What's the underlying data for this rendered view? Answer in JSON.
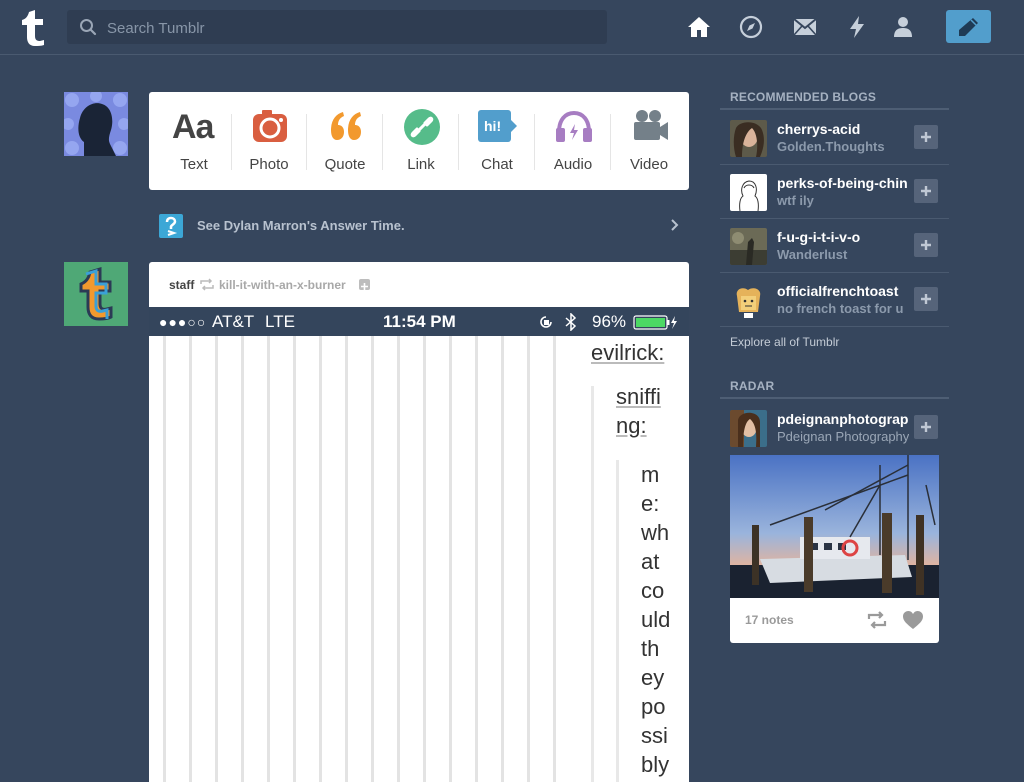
{
  "search": {
    "placeholder": "Search Tumblr"
  },
  "post_types": [
    {
      "label": "Text"
    },
    {
      "label": "Photo"
    },
    {
      "label": "Quote"
    },
    {
      "label": "Link"
    },
    {
      "label": "Chat",
      "icon_text": "hi!"
    },
    {
      "label": "Audio"
    },
    {
      "label": "Video"
    }
  ],
  "post_type_icon_glyph": "Aa",
  "answer_time": {
    "text": "See Dylan Marron's Answer Time."
  },
  "post": {
    "author": "staff",
    "reblogged_from": "kill-it-with-an-x-burner",
    "status_bar": {
      "signal": "●●●○○",
      "carrier": "AT&T",
      "network": "LTE",
      "time": "11:54 PM",
      "battery": "96%"
    },
    "screenshot_lines": {
      "level1": "evilrick:",
      "level2": [
        "sniffi",
        "ng:"
      ],
      "level3": [
        "m",
        "e:",
        "wh",
        "at",
        "co",
        "uld",
        "th",
        "ey",
        "po",
        "ssi",
        "bly"
      ]
    }
  },
  "recommended": {
    "title": "RECOMMENDED BLOGS",
    "blogs": [
      {
        "name": "cherrys-acid",
        "tagline": "Golden.Thoughts"
      },
      {
        "name": "perks-of-being-chin",
        "tagline": "wtf ily"
      },
      {
        "name": "f-u-g-i-t-i-v-o",
        "tagline": "Wanderlust"
      },
      {
        "name": "officialfrenchtoast",
        "tagline": "no french toast for u"
      }
    ],
    "explore": "Explore all of Tumblr"
  },
  "radar": {
    "title": "RADAR",
    "blog": {
      "name": "pdeignanphotography",
      "tagline": "Pdeignan Photography"
    },
    "notes": "17 notes"
  },
  "colors": {
    "background": "#36465d",
    "accent": "#529ecc",
    "photo": "#d95e40",
    "quote": "#f2992e",
    "link": "#56bc8a",
    "chat": "#529ecc",
    "audio": "#a77dc2",
    "video": "#748089"
  }
}
